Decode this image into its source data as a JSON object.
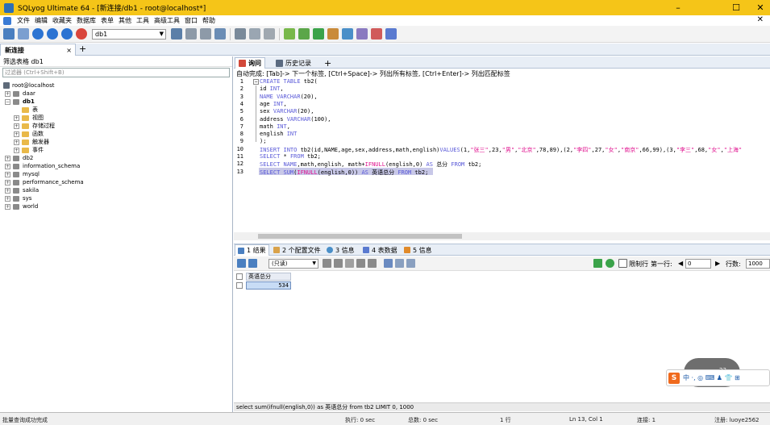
{
  "window": {
    "title": "SQLyog Ultimate 64 - [新连接/db1 - root@localhost*]",
    "controls": {
      "minimize": "–",
      "maximize": "☐",
      "close": "✕"
    }
  },
  "menu": {
    "items": [
      "文件",
      "编辑",
      "收藏夹",
      "数据库",
      "表单",
      "其他",
      "工具",
      "高级工具",
      "窗口",
      "帮助"
    ],
    "close_label": "✕"
  },
  "toolbar": {
    "db_select": "db1",
    "arrow": "▼"
  },
  "connection": {
    "tab_label": "新连接",
    "close": "×",
    "add": "+"
  },
  "left_panel": {
    "header": "筛选表格 db1",
    "filter_placeholder": "过滤器 (Ctrl+Shift+B)",
    "root": "root@localhost",
    "dbs": [
      "daar",
      "db1"
    ],
    "db1_children": [
      "表",
      "视图",
      "存储过程",
      "函数",
      "触发器",
      "事件"
    ],
    "other_dbs": [
      "db2",
      "information_schema",
      "mysql",
      "performance_schema",
      "sakila",
      "sys",
      "world"
    ]
  },
  "query": {
    "tabs": [
      "询问",
      "历史记录"
    ],
    "add": "+",
    "hint": "自动完成: [Tab]-> 下一个标签, [Ctrl+Space]-> 列出所有标签, [Ctrl+Enter]-> 列出匹配标签",
    "line_numbers": [
      "1",
      "2",
      "3",
      "4",
      "5",
      "6",
      "7",
      "8",
      "9",
      "10",
      "11",
      "12",
      "13"
    ],
    "fold_toggle": "−",
    "lines": [
      [
        {
          "c": "kw",
          "t": "CREATE TABLE "
        },
        {
          "c": "",
          "t": "tb2("
        }
      ],
      [
        {
          "c": "",
          "t": "id "
        },
        {
          "c": "kw",
          "t": "INT"
        },
        {
          "c": "",
          "t": ","
        }
      ],
      [
        {
          "c": "kw",
          "t": "NAME VARCHAR"
        },
        {
          "c": "",
          "t": "(20),"
        }
      ],
      [
        {
          "c": "",
          "t": "age "
        },
        {
          "c": "kw",
          "t": "INT"
        },
        {
          "c": "",
          "t": ","
        }
      ],
      [
        {
          "c": "",
          "t": "sex "
        },
        {
          "c": "kw",
          "t": "VARCHAR"
        },
        {
          "c": "",
          "t": "(20),"
        }
      ],
      [
        {
          "c": "",
          "t": "address "
        },
        {
          "c": "kw",
          "t": "VARCHAR"
        },
        {
          "c": "",
          "t": "(100),"
        }
      ],
      [
        {
          "c": "",
          "t": "math "
        },
        {
          "c": "kw",
          "t": "INT"
        },
        {
          "c": "",
          "t": ","
        }
      ],
      [
        {
          "c": "",
          "t": "english "
        },
        {
          "c": "kw",
          "t": "INT"
        }
      ],
      [
        {
          "c": "",
          "t": ");"
        }
      ],
      [
        {
          "c": "kw",
          "t": "INSERT INTO "
        },
        {
          "c": "",
          "t": "tb2(id,NAME,age,sex,address,math,english)"
        },
        {
          "c": "kw",
          "t": "VALUES"
        },
        {
          "c": "",
          "t": "(1,"
        },
        {
          "c": "str",
          "t": "\"张三\""
        },
        {
          "c": "",
          "t": ",23,"
        },
        {
          "c": "str",
          "t": "\"男\""
        },
        {
          "c": "",
          "t": ","
        },
        {
          "c": "str",
          "t": "\"北京\""
        },
        {
          "c": "",
          "t": ",78,89),(2,"
        },
        {
          "c": "str",
          "t": "\"李四\""
        },
        {
          "c": "",
          "t": ",27,"
        },
        {
          "c": "str",
          "t": "\"女\""
        },
        {
          "c": "",
          "t": ","
        },
        {
          "c": "str",
          "t": "\"南京\""
        },
        {
          "c": "",
          "t": ",66,99),(3,"
        },
        {
          "c": "str",
          "t": "\"李三\""
        },
        {
          "c": "",
          "t": ",68,"
        },
        {
          "c": "str",
          "t": "\"女\""
        },
        {
          "c": "",
          "t": ","
        },
        {
          "c": "str",
          "t": "\"上海\""
        }
      ],
      [
        {
          "c": "kw",
          "t": "SELECT "
        },
        {
          "c": "",
          "t": "* "
        },
        {
          "c": "kw",
          "t": "FROM "
        },
        {
          "c": "",
          "t": "tb2;"
        }
      ],
      [
        {
          "c": "kw",
          "t": "SELECT NAME"
        },
        {
          "c": "",
          "t": ",math,english, math+"
        },
        {
          "c": "str",
          "t": "IFNULL"
        },
        {
          "c": "",
          "t": "(english,0) "
        },
        {
          "c": "kw",
          "t": "AS "
        },
        {
          "c": "",
          "t": "总分 "
        },
        {
          "c": "kw",
          "t": "FROM "
        },
        {
          "c": "",
          "t": "tb2;"
        }
      ],
      [
        {
          "c": "kw",
          "t": "SELECT SUM"
        },
        {
          "c": "",
          "t": "("
        },
        {
          "c": "str",
          "t": "IFNULL"
        },
        {
          "c": "",
          "t": "(english,0)) "
        },
        {
          "c": "kw",
          "t": "AS "
        },
        {
          "c": "",
          "t": "英语总分 "
        },
        {
          "c": "kw",
          "t": "FROM "
        },
        {
          "c": "",
          "t": "tb2;"
        }
      ]
    ]
  },
  "results": {
    "tabs": [
      "1 结果",
      "2 个配置文件",
      "3 信息",
      "4 表数据",
      "5 信息"
    ],
    "mode": "(只读)",
    "mode_arrow": "▼",
    "limit_label": "限制行",
    "first_row_label": "第一行:",
    "first_row_value": "0",
    "rows_label": "行数:",
    "rows_value": "1000",
    "column_header": "英语总分",
    "value": "534"
  },
  "ime": {
    "logo": "S",
    "text": "中 ·, ◎ ⌨ ♟ 👕 ⊞",
    "badge": "23"
  },
  "sql_status": "select sum(ifnull(english,0)) as 英语总分 from tb2 LIMIT 0, 1000",
  "status": {
    "left": "批量查询成功完成",
    "exec": "执行: 0 sec",
    "total": "总数: 0 sec",
    "rows": "1 行",
    "pos": "Ln 13, Col 1",
    "conn": "连接: 1",
    "reg": "注册: luoye2562"
  },
  "colors": {
    "titlebar": "#f5c518",
    "keyword": "#5a5ad8",
    "string": "#e0138f",
    "selection": "#c8c8e8"
  }
}
